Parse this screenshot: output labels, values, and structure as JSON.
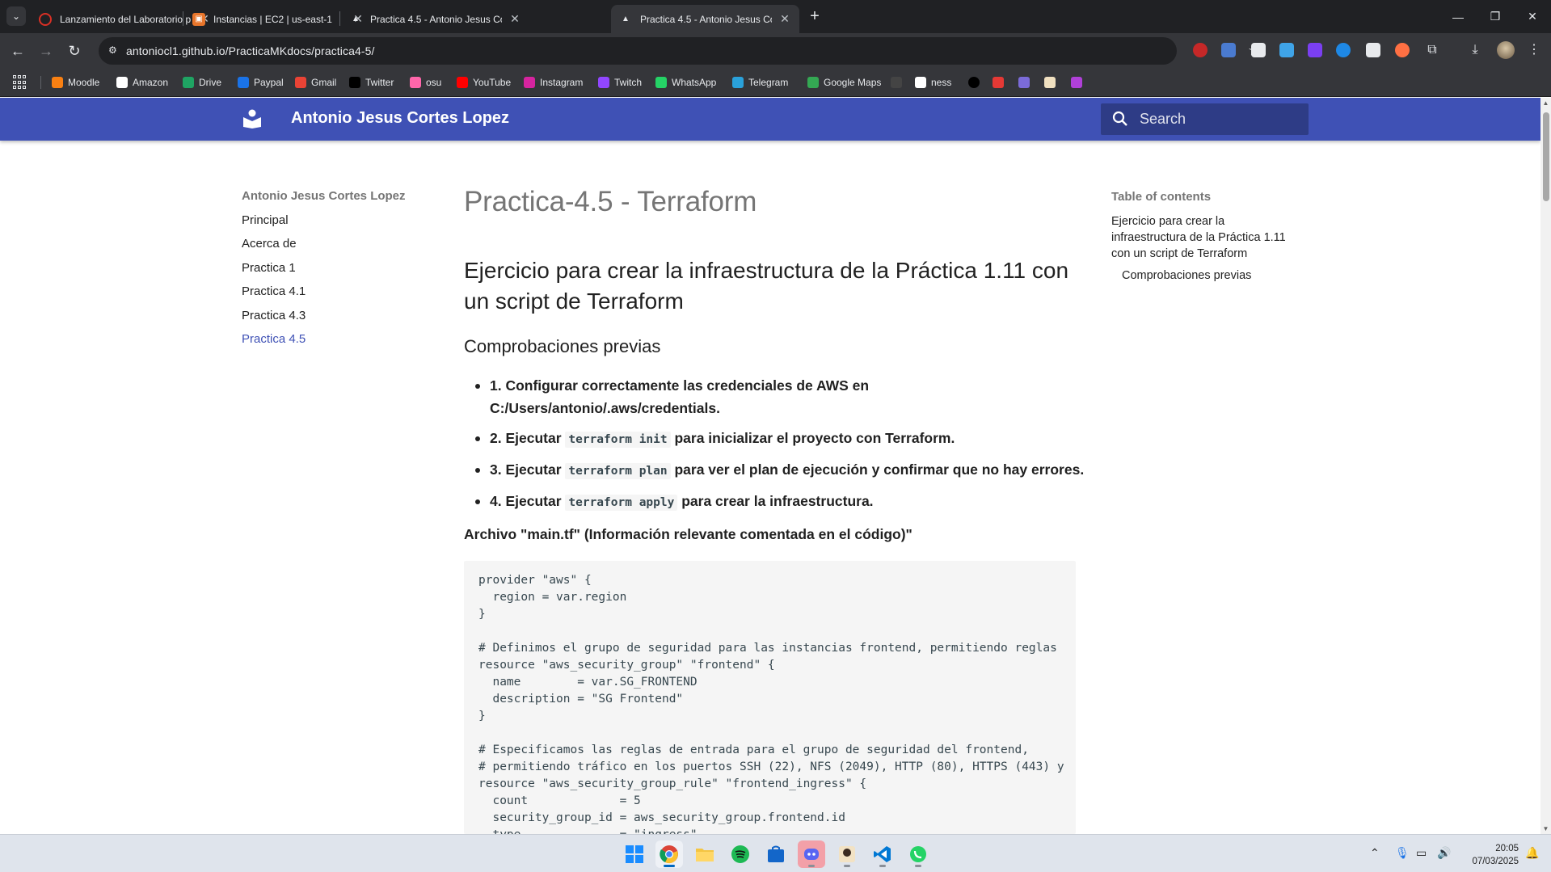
{
  "browser": {
    "tabs": [
      {
        "title": "Lanzamiento del Laboratorio p",
        "favicon": "lab-icon",
        "color": "#d93025",
        "active": false
      },
      {
        "title": "Instancias | EC2 | us-east-1",
        "favicon": "aws-icon",
        "color": "#e8762c",
        "active": false
      },
      {
        "title": "Practica 4.5 - Antonio Jesus Cor",
        "favicon": "mkdocs-icon",
        "color": "#ffffff",
        "active": false
      },
      {
        "title": "Practica 4.5 - Antonio Jesus Cor",
        "favicon": "mkdocs-icon",
        "color": "#ffffff",
        "active": true
      }
    ],
    "url": "antoniocl1.github.io/PracticaMKdocs/practica4-5/",
    "bookmarks": [
      {
        "label": "Moodle",
        "icon": "moodle-icon",
        "color": "#f98012"
      },
      {
        "label": "Amazon",
        "icon": "amazon-icon",
        "color": "#ffffff"
      },
      {
        "label": "Drive",
        "icon": "drive-icon",
        "color": "#1fa463"
      },
      {
        "label": "Paypal",
        "icon": "paypal-icon",
        "color": "#1a73e8"
      },
      {
        "label": "Gmail",
        "icon": "gmail-icon",
        "color": "#ea4335"
      },
      {
        "label": "Twitter",
        "icon": "x-icon",
        "color": "#000000"
      },
      {
        "label": "osu",
        "icon": "osu-icon",
        "color": "#ff66aa"
      },
      {
        "label": "YouTube",
        "icon": "youtube-icon",
        "color": "#ff0000"
      },
      {
        "label": "Instagram",
        "icon": "instagram-icon",
        "color": "#d6249f"
      },
      {
        "label": "Twitch",
        "icon": "twitch-icon",
        "color": "#9146ff"
      },
      {
        "label": "WhatsApp",
        "icon": "whatsapp-icon",
        "color": "#25d366"
      },
      {
        "label": "Telegram",
        "icon": "telegram-icon",
        "color": "#2aa1da"
      },
      {
        "label": "Google Maps",
        "icon": "maps-icon",
        "color": "#34a853"
      },
      {
        "label": "",
        "icon": "gg-icon",
        "color": "#444444"
      },
      {
        "label": "ness",
        "icon": "wordpress-icon",
        "color": "#ffffff"
      }
    ]
  },
  "site": {
    "title": "Antonio Jesus Cortes Lopez",
    "search_placeholder": "Search",
    "accent": "#3f51b5"
  },
  "nav": {
    "title": "Antonio Jesus Cortes Lopez",
    "items": [
      "Principal",
      "Acerca de",
      "Practica 1",
      "Practica 4.1",
      "Practica 4.3",
      "Practica 4.5"
    ],
    "active": "Practica 4.5"
  },
  "content": {
    "h1": "Practica-4.5 - Terraform",
    "h2": "Ejercicio para crear la infraestructura de la Práctica 1.11 con un script de Terraform",
    "h3": "Comprobaciones previas",
    "steps": [
      {
        "pre": "1. Configurar correctamente las credenciales de AWS en C:/Users/antonio/.aws/credentials.",
        "code": "",
        "post": ""
      },
      {
        "pre": "2. Ejecutar ",
        "code": "terraform init",
        "post": " para inicializar el proyecto con Terraform."
      },
      {
        "pre": "3. Ejecutar ",
        "code": "terraform plan",
        "post": " para ver el plan de ejecución y confirmar que no hay errores."
      },
      {
        "pre": "4. Ejecutar ",
        "code": "terraform apply",
        "post": " para crear la infraestructura."
      }
    ],
    "file_label": "Archivo \"main.tf\" (Información relevante comentada en el código)\"",
    "code": "provider \"aws\" {\n  region = var.region\n}\n\n# Definimos el grupo de seguridad para las instancias frontend, permitiendo reglas\nresource \"aws_security_group\" \"frontend\" {\n  name        = var.SG_FRONTEND\n  description = \"SG Frontend\"\n}\n\n# Especificamos las reglas de entrada para el grupo de seguridad del frontend,\n# permitiendo tráfico en los puertos SSH (22), NFS (2049), HTTP (80), HTTPS (443) y\nresource \"aws_security_group_rule\" \"frontend_ingress\" {\n  count             = 5\n  security_group_id = aws_security_group.frontend.id\n  type              = \"ingress\""
  },
  "toc": {
    "title": "Table of contents",
    "items": [
      "Ejercicio para crear la infraestructura de la Práctica 1.11 con un script de Terraform"
    ],
    "sub_items": [
      "Comprobaciones previas"
    ]
  },
  "taskbar": {
    "time": "20:05",
    "date": "07/03/2025",
    "apps": [
      "windows-start-icon",
      "chrome-icon",
      "file-explorer-icon",
      "spotify-icon",
      "store-icon",
      "discord-icon",
      "app-icon",
      "vscode-icon",
      "whatsapp-icon"
    ]
  }
}
